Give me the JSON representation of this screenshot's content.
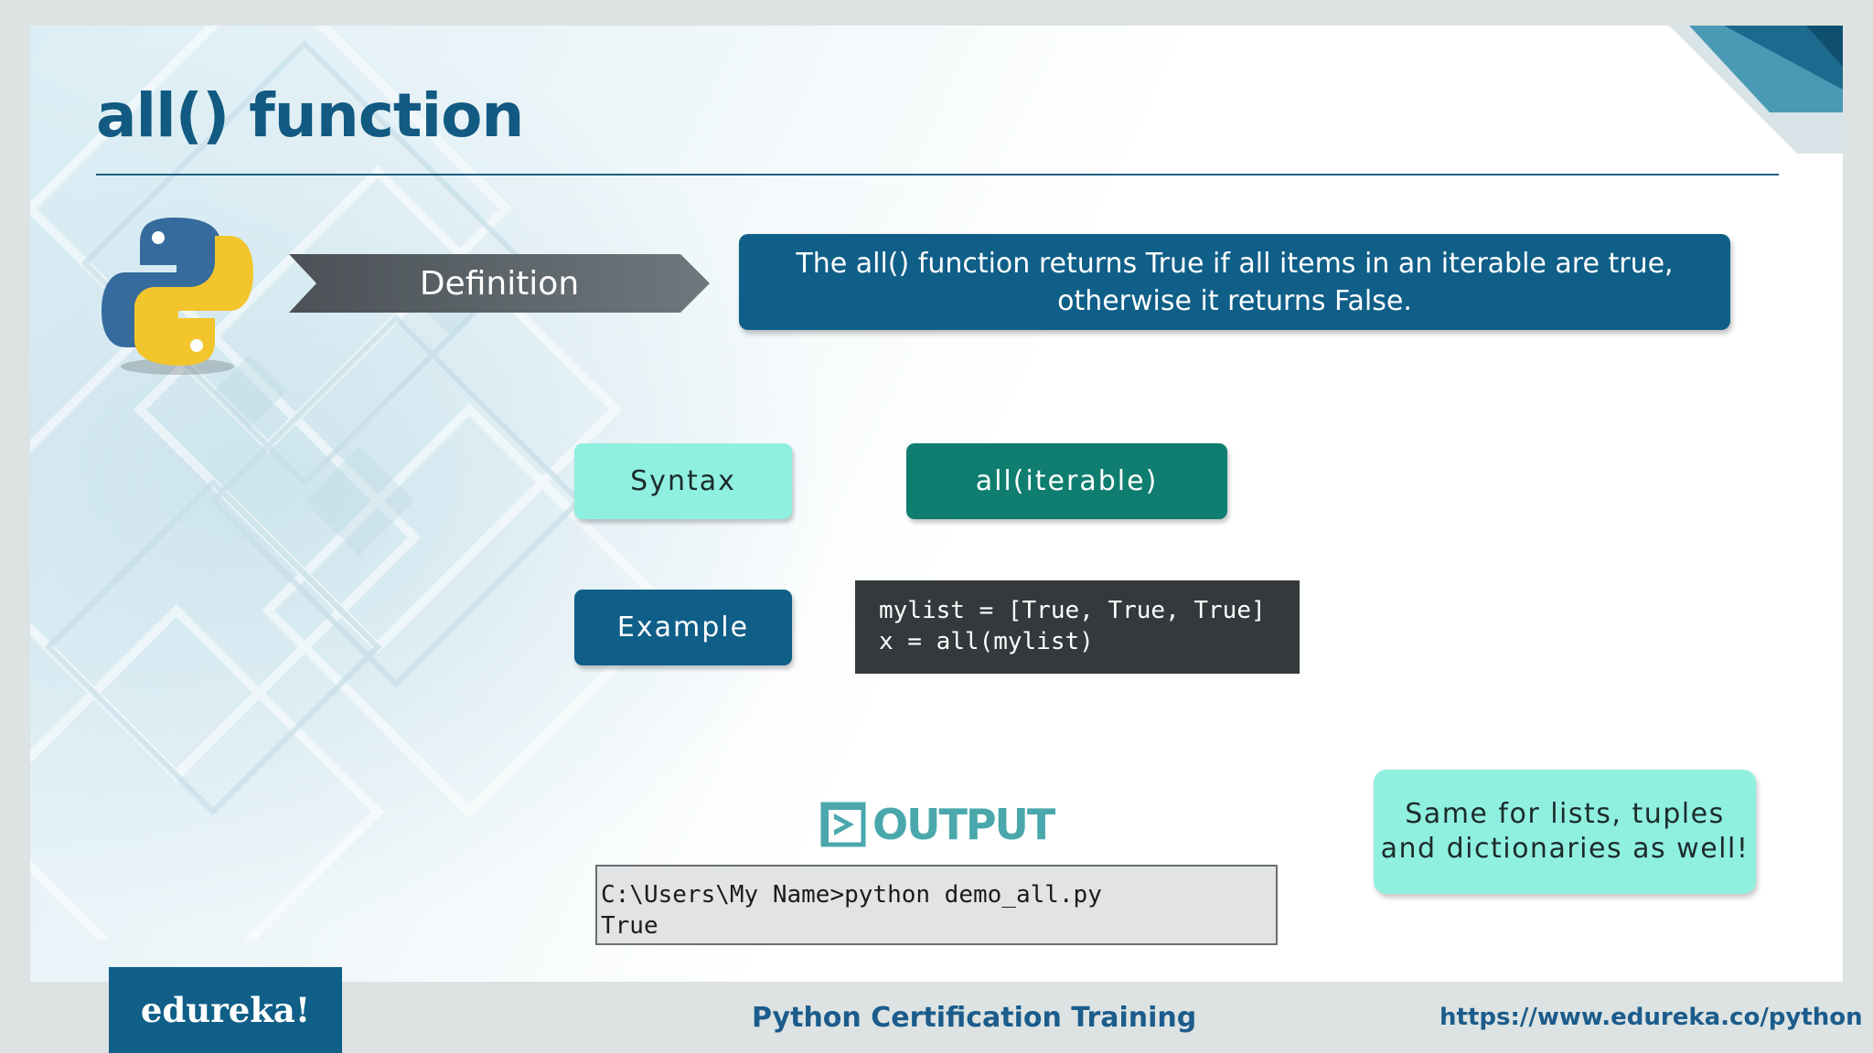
{
  "slide": {
    "title": "all() function",
    "definition": {
      "label": "Definition",
      "text_lines": [
        "The all() function returns True if all items in an iterable are true,",
        "otherwise it returns False."
      ]
    },
    "syntax": {
      "label": "Syntax",
      "code": "all(iterable)"
    },
    "example": {
      "label": "Example",
      "code_lines": [
        "mylist = [True, True, True]",
        "x = all(mylist)"
      ]
    },
    "output": {
      "label": "OUTPUT",
      "console_lines": [
        "C:\\Users\\My Name>python demo_all.py",
        "True"
      ]
    },
    "note": {
      "lines": [
        "Same for lists, tuples",
        "and dictionaries as well!"
      ]
    }
  },
  "footer": {
    "brand": "edureka!",
    "course": "Python Certification Training",
    "url": "https://www.edureka.co/python"
  },
  "colors": {
    "title_blue": "#125a82",
    "navy_box": "#0f5f88",
    "teal_dark": "#0f7d6f",
    "aqua_light": "#8ff0e0",
    "code_bg": "#34393c",
    "output_teal": "#4aa8ad"
  },
  "icons": [
    "python-logo-icon",
    "output-play-icon"
  ]
}
